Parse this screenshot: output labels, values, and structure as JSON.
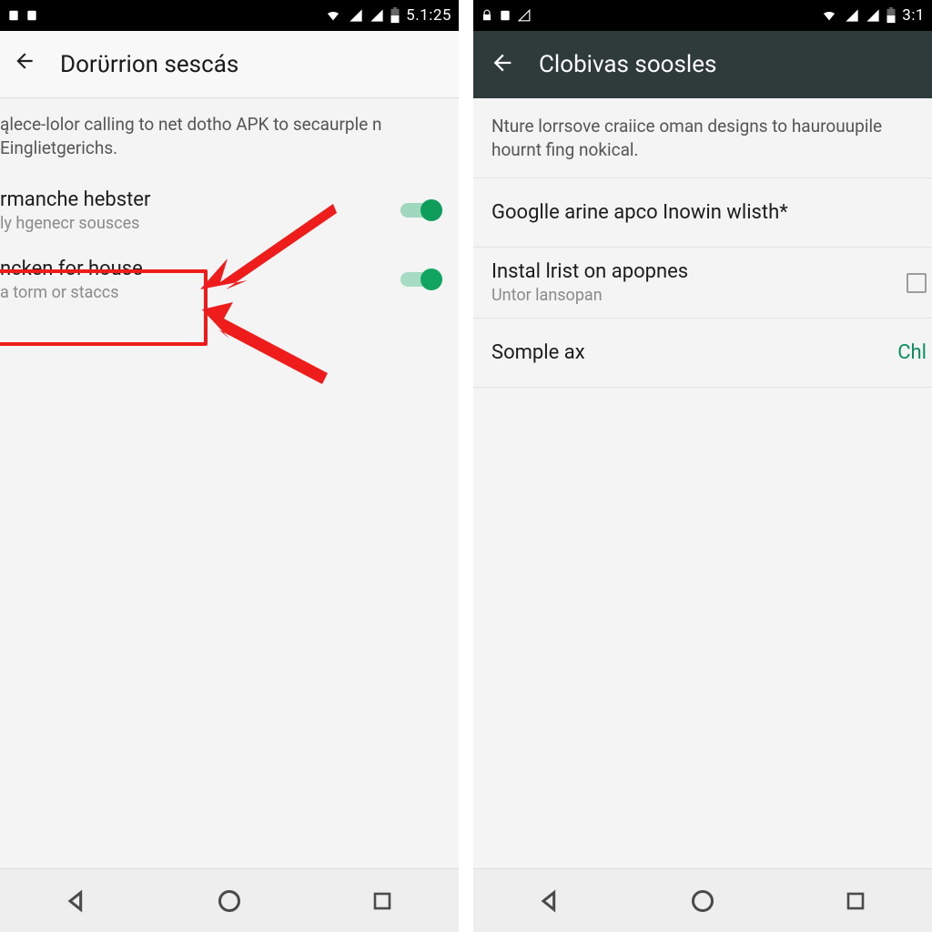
{
  "left": {
    "statusbar": {
      "time": "5.1:25"
    },
    "appbar": {
      "title": "Dorϋrrion sescás"
    },
    "desc": "ąlece-lolor calling to net dotho APK to secaurple n Einglietgerichs.",
    "rows": [
      {
        "primary": "rmanche hebster",
        "secondary": "ly hgenecr sousces",
        "toggle": true
      },
      {
        "primary": "ncken for house",
        "secondary": "a torm or staccs",
        "toggle": true
      }
    ]
  },
  "right": {
    "statusbar": {
      "time": "3:1"
    },
    "appbar": {
      "title": "Clobivas soosles"
    },
    "desc": "Nture lorrsove craiice oman designs to haurouupile hournt fing nokical.",
    "rows": [
      {
        "primary": "Googlle arine apco Inowin wlisth*"
      },
      {
        "primary": "Instal lrist on apopnes",
        "secondary": "Untor lansopan",
        "checkbox": true
      },
      {
        "primary": "Somple ax",
        "value": "Chl"
      }
    ]
  },
  "colors": {
    "accent": "#0e9d5b",
    "annotation": "#ef1c1c"
  }
}
